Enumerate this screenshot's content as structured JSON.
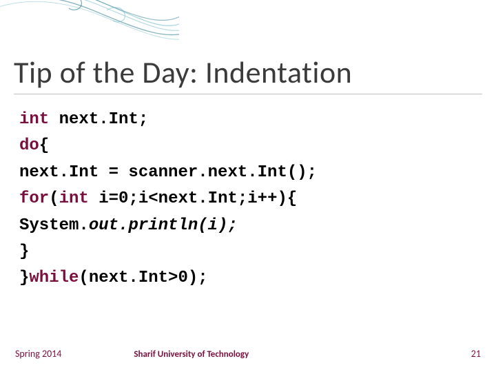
{
  "title": "Tip of the Day: Indentation",
  "code": {
    "l1_kw": "int",
    "l1_rest": " next.Int;",
    "l2_kw": "do",
    "l2_rest": "{",
    "l3": "next.Int = scanner.next.Int();",
    "l4_kw1": "for",
    "l4_mid1": "(",
    "l4_kw2": "int",
    "l4_rest": " i=0;i<next.Int;i++){",
    "l5a": "System.",
    "l5b": "out",
    "l5c": ".println(i);",
    "l6": "}",
    "l7a": "}",
    "l7_kw": "while",
    "l7b": "(next.Int>0);"
  },
  "footer": {
    "left": "Spring 2014",
    "center": "Sharif University of Technology",
    "right": "21"
  },
  "colors": {
    "keyword": "#7a0f3e",
    "title": "#3b3b3b",
    "underline": "#bfbfbf",
    "swirl1": "#2a7a8c",
    "swirl2": "#6fb7c7"
  }
}
